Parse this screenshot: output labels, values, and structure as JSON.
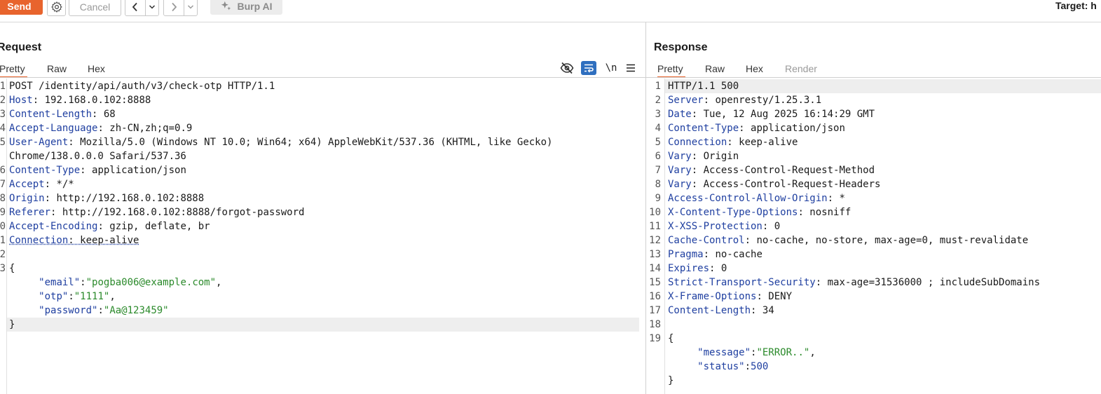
{
  "toolbar": {
    "send": "Send",
    "cancel": "Cancel",
    "burp_ai": "Burp AI",
    "target": "Target: h"
  },
  "request": {
    "title": "Request",
    "tabs": [
      "Pretty",
      "Raw",
      "Hex"
    ],
    "active_tab": "Pretty",
    "tools": {
      "newline": "\\n"
    },
    "line_numbers": [
      "1",
      "2",
      "3",
      "4",
      "5",
      "",
      "6",
      "7",
      "8",
      "9",
      "0",
      "1",
      "2",
      "3",
      "",
      "",
      "",
      ""
    ],
    "lines": [
      {
        "key": "",
        "value": "POST /identity/api/auth/v3/check-otp HTTP/1.1"
      },
      {
        "key": "Host",
        "value": " 192.168.0.102:8888"
      },
      {
        "key": "Content-Length",
        "value": " 68"
      },
      {
        "key": "Accept-Language",
        "value": " zh-CN,zh;q=0.9"
      },
      {
        "key": "User-Agent",
        "value": " Mozilla/5.0 (Windows NT 10.0; Win64; x64) AppleWebKit/537.36 (KHTML, like Gecko)"
      },
      {
        "key": "",
        "value": "Chrome/138.0.0.0 Safari/537.36"
      },
      {
        "key": "Content-Type",
        "value": " application/json"
      },
      {
        "key": "Accept",
        "value": " */*"
      },
      {
        "key": "Origin",
        "value": " http://192.168.0.102:8888"
      },
      {
        "key": "Referer",
        "value": " http://192.168.0.102:8888/forgot-password"
      },
      {
        "key": "Accept-Encoding",
        "value": " gzip, deflate, br"
      },
      {
        "key": "Connection",
        "value": " keep-alive"
      }
    ],
    "body": {
      "open": "{",
      "fields": [
        {
          "key": "\"email\"",
          "value": "\"pogba006@example.com\"",
          "type": "string",
          "comma": ","
        },
        {
          "key": "\"otp\"",
          "value": "\"1111\"",
          "type": "string",
          "comma": ","
        },
        {
          "key": "\"password\"",
          "value": "\"Aa@123459\"",
          "type": "string",
          "comma": ""
        }
      ],
      "close": "}"
    }
  },
  "response": {
    "title": "Response",
    "tabs": [
      "Pretty",
      "Raw",
      "Hex",
      "Render"
    ],
    "active_tab": "Pretty",
    "line_numbers": [
      "1",
      "2",
      "3",
      "4",
      "5",
      "6",
      "7",
      "8",
      "9",
      "10",
      "11",
      "12",
      "13",
      "14",
      "15",
      "16",
      "17",
      "18",
      "19"
    ],
    "lines": [
      {
        "key": "",
        "value": "HTTP/1.1 500"
      },
      {
        "key": "Server",
        "value": " openresty/1.25.3.1"
      },
      {
        "key": "Date",
        "value": " Tue, 12 Aug 2025 16:14:29 GMT"
      },
      {
        "key": "Content-Type",
        "value": " application/json"
      },
      {
        "key": "Connection",
        "value": " keep-alive"
      },
      {
        "key": "Vary",
        "value": " Origin"
      },
      {
        "key": "Vary",
        "value": " Access-Control-Request-Method"
      },
      {
        "key": "Vary",
        "value": " Access-Control-Request-Headers"
      },
      {
        "key": "Access-Control-Allow-Origin",
        "value": " *"
      },
      {
        "key": "X-Content-Type-Options",
        "value": " nosniff"
      },
      {
        "key": "X-XSS-Protection",
        "value": " 0"
      },
      {
        "key": "Cache-Control",
        "value": " no-cache, no-store, max-age=0, must-revalidate"
      },
      {
        "key": "Pragma",
        "value": " no-cache"
      },
      {
        "key": "Expires",
        "value": " 0"
      },
      {
        "key": "Strict-Transport-Security",
        "value": " max-age=31536000 ; includeSubDomains"
      },
      {
        "key": "X-Frame-Options",
        "value": " DENY"
      },
      {
        "key": "Content-Length",
        "value": " 34"
      }
    ],
    "body": {
      "open": "{",
      "fields": [
        {
          "key": "\"message\"",
          "value": "\"ERROR..\"",
          "type": "string",
          "comma": ","
        },
        {
          "key": "\"status\"",
          "value": "500",
          "type": "number",
          "comma": ""
        }
      ],
      "close": "}"
    }
  },
  "colors": {
    "accent": "#e8642d",
    "header_key": "#1f3fa0",
    "json_string": "#2b8a2b"
  }
}
